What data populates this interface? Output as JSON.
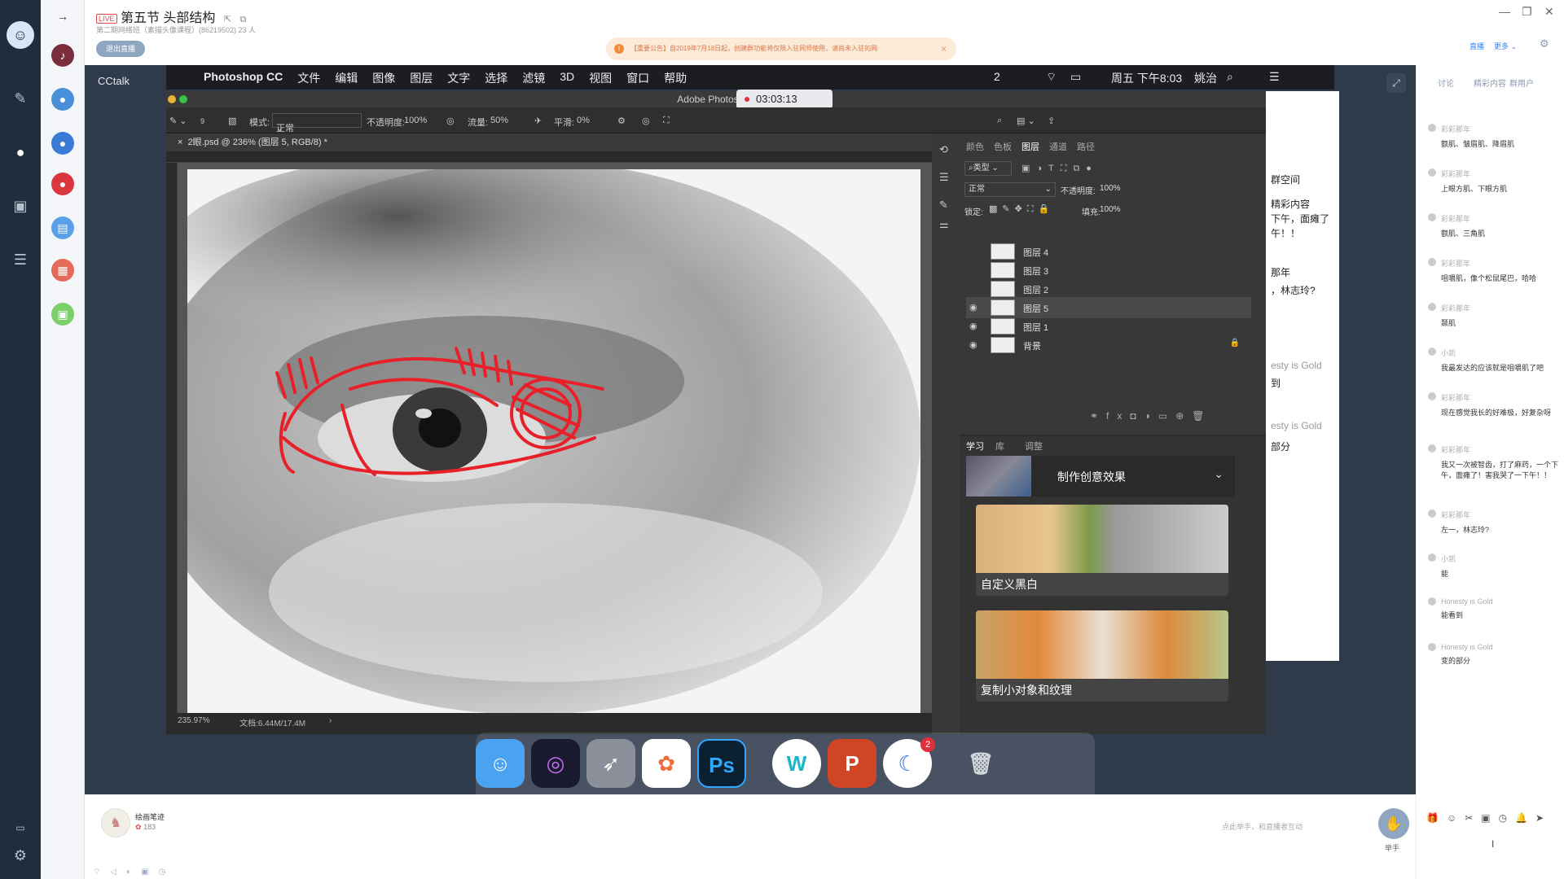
{
  "header": {
    "live_badge": "LIVE",
    "title": "第五节 头部结构",
    "subtitle": "第二期网络班（素描头像课程）(86219502)  23 人",
    "end_live": "退出直播",
    "notice": "【重要公告】自2019年7月18日起，创建群功能将仅限入驻网师使用，请尚未入驻的网",
    "right_btn1": "直播",
    "right_btn2": "更多"
  },
  "video": {
    "app_label": "CCtalk",
    "timer": "03:03:13"
  },
  "mac_menu": {
    "items": [
      "Photoshop CC",
      "文件",
      "编辑",
      "图像",
      "图层",
      "文字",
      "选择",
      "滤镜",
      "3D",
      "视图",
      "窗口",
      "帮助"
    ],
    "status": [
      "2",
      "周五 下午8:03",
      "姚治"
    ]
  },
  "photoshop": {
    "window_title": "Adobe Photoshop",
    "options": {
      "mode_label": "模式:",
      "mode_value": "正常",
      "opacity_label": "不透明度:",
      "opacity_value": "100%",
      "flow_label": "流量:",
      "flow_value": "50%",
      "smooth_label": "平滑:",
      "smooth_value": "0%",
      "brush_size": "9"
    },
    "doc_tab": "2眼.psd @ 236% (图层 5, RGB/8) *",
    "status_zoom": "235.97%",
    "status_doc": "文档:6.44M/17.4M",
    "panel_tabs": [
      "颜色",
      "色板",
      "图层",
      "通道",
      "路径"
    ],
    "filter_kind": "类型",
    "blend_mode": "正常",
    "layer_opacity_label": "不透明度:",
    "layer_opacity": "100%",
    "lock_label": "锁定:",
    "fill_label": "填充:",
    "fill_value": "100%",
    "layers": [
      {
        "name": "图层 4",
        "visible": false,
        "selected": false
      },
      {
        "name": "图层 3",
        "visible": false,
        "selected": false
      },
      {
        "name": "图层 2",
        "visible": false,
        "selected": false
      },
      {
        "name": "图层 5",
        "visible": true,
        "selected": true
      },
      {
        "name": "图层 1",
        "visible": true,
        "selected": false
      },
      {
        "name": "背景",
        "visible": true,
        "selected": false
      }
    ],
    "learn_tabs": [
      "学习",
      "库",
      "调整"
    ],
    "learn_heading": "制作创意效果",
    "cards": [
      "自定义黑白",
      "复制小对象和纹理"
    ]
  },
  "chat_peek": {
    "lines": [
      "群空间",
      "精彩内容",
      "下午，面瘫了",
      "午！！",
      "那年",
      "，林志玲?",
      "esty is Gold",
      "到",
      "esty is Gold",
      "部分"
    ]
  },
  "bottom": {
    "user_name": "绘画笔迹",
    "likes": "183",
    "hint": "点此举手，和直播者互动",
    "raise_hand": "举手"
  },
  "chat": {
    "tabs": [
      "讨论",
      "精彩内容",
      "群用户"
    ],
    "messages": [
      {
        "who": "彩彩那年",
        "text": "额肌、皱眉肌、降眉肌"
      },
      {
        "who": "彩彩那年",
        "text": "上眼方肌、下眼方肌"
      },
      {
        "who": "彩彩那年",
        "text": "额肌、三角肌"
      },
      {
        "who": "彩彩那年",
        "text": "咀嚼肌，像个松鼠尾巴，哈哈"
      },
      {
        "who": "彩彩那年",
        "text": "颞肌"
      },
      {
        "who": "小凯",
        "text": "我最发达的应该就是咀嚼肌了吧"
      },
      {
        "who": "彩彩那年",
        "text": "现在感觉我长的好难极，好复杂呀"
      },
      {
        "who": "彩彩那年",
        "text": "我又一次被智齿，打了麻药，一个下午，面瘫了！害我哭了一下午！！"
      },
      {
        "who": "彩彩那年",
        "text": "左一，林志玲?"
      },
      {
        "who": "小凯",
        "text": "能"
      },
      {
        "who": "Honesty is Gold",
        "text": "能看到"
      },
      {
        "who": "Honesty is Gold",
        "text": "变的部分"
      }
    ]
  },
  "colors": {
    "accent": "#3b82f6",
    "sidebar_dark": "#1f2d3d",
    "ps_panel": "#383838",
    "sketch_red": "#e8202a"
  }
}
